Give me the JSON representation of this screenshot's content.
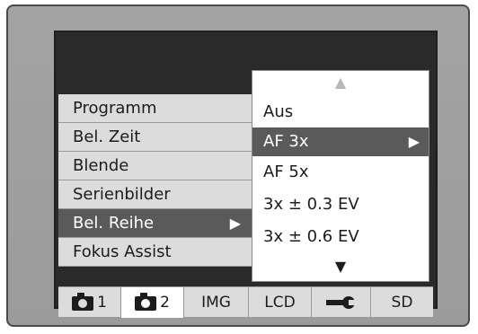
{
  "left_menu": {
    "items": [
      {
        "label": "Programm"
      },
      {
        "label": "Bel. Zeit"
      },
      {
        "label": "Blende"
      },
      {
        "label": "Serienbilder"
      },
      {
        "label": "Bel. Reihe",
        "arrow": "▶"
      },
      {
        "label": "Fokus Assist"
      }
    ]
  },
  "submenu": {
    "scroll_up": "▲",
    "items": [
      {
        "label": "Aus"
      },
      {
        "label": "AF 3x",
        "arrow": "▶"
      },
      {
        "label": "AF 5x"
      },
      {
        "label": "3x ± 0.3 EV"
      },
      {
        "label": "3x ± 0.6 EV"
      }
    ],
    "scroll_down": "▼"
  },
  "tabs": [
    {
      "icon": "camera-icon",
      "label": "1"
    },
    {
      "icon": "camera-icon",
      "label": "2"
    },
    {
      "label": "IMG"
    },
    {
      "label": "LCD"
    },
    {
      "icon": "wrench-icon"
    },
    {
      "label": "SD"
    }
  ]
}
